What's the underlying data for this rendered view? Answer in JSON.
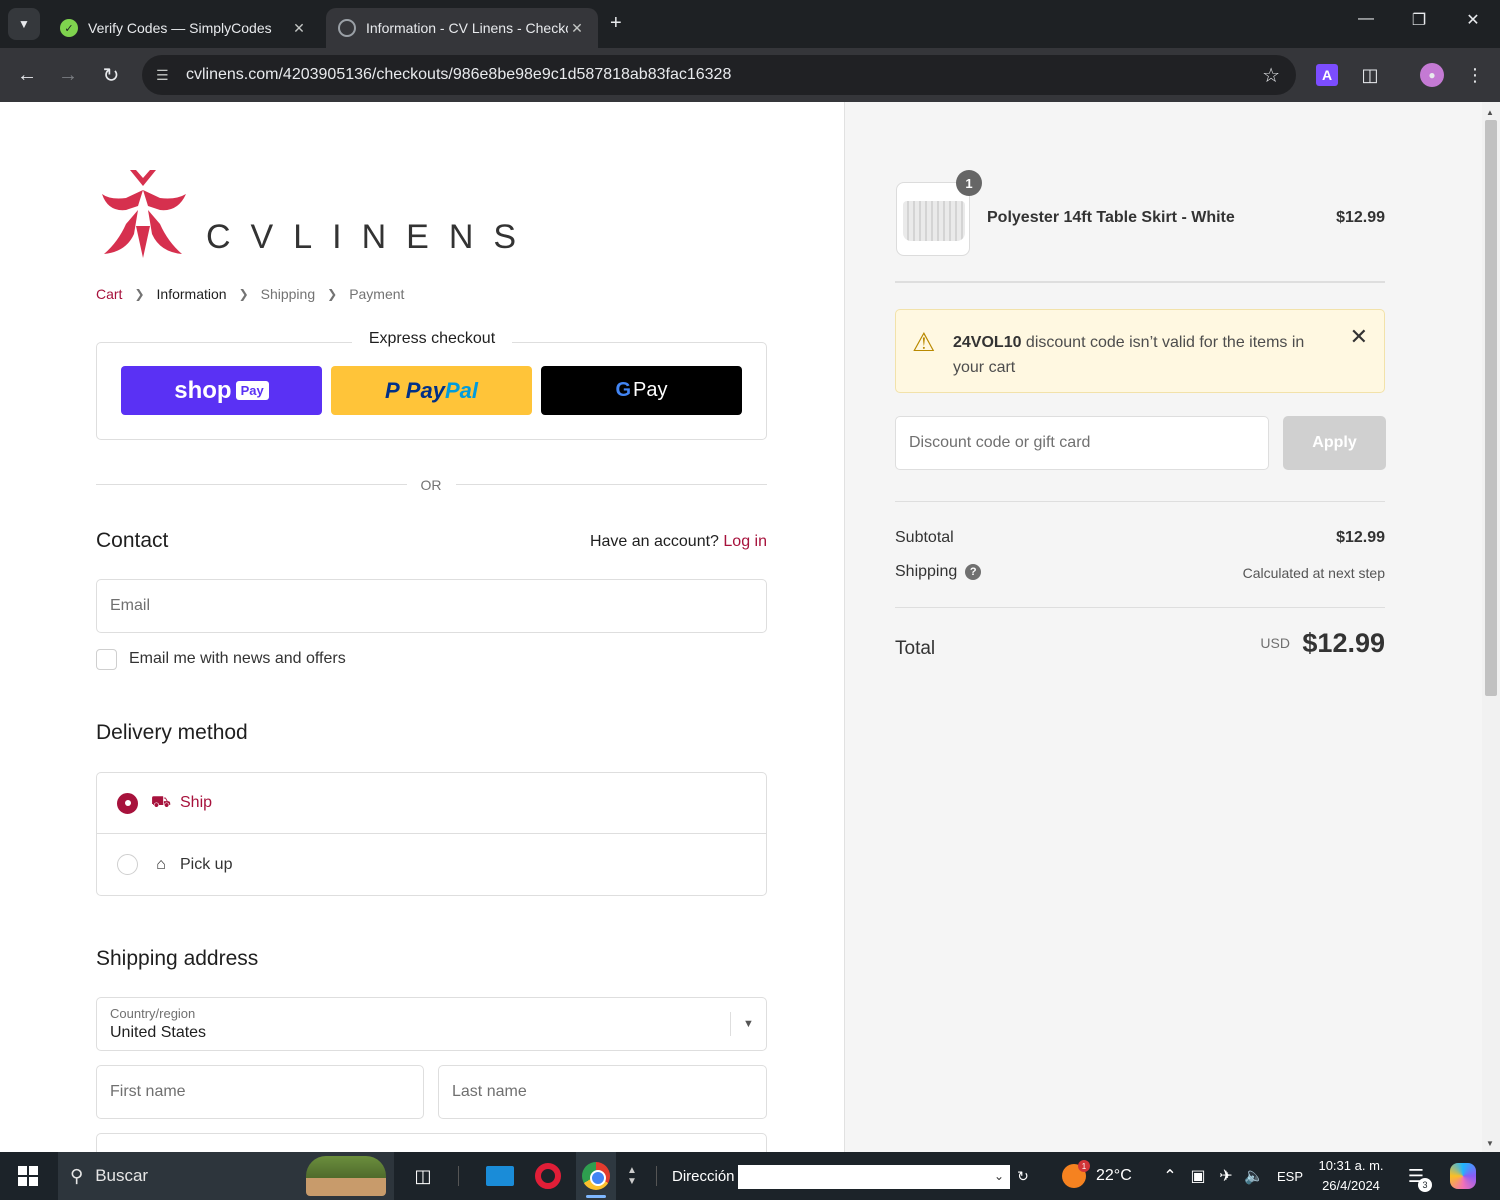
{
  "browser": {
    "tabs": [
      {
        "title": "Verify Codes — SimplyCodes",
        "active": false
      },
      {
        "title": "Information - CV Linens - Checkout",
        "active": true
      }
    ],
    "url": "cvlinens.com/4203905136/checkouts/986e8be98e9c1d587818ab83fac16328",
    "extension_letter": "A"
  },
  "logo": {
    "wordmark": "CVLINENS",
    "brand_color": "#d6304e"
  },
  "breadcrumbs": [
    {
      "label": "Cart",
      "state": "link"
    },
    {
      "label": "Information",
      "state": "current"
    },
    {
      "label": "Shipping",
      "state": "upcoming"
    },
    {
      "label": "Payment",
      "state": "upcoming"
    }
  ],
  "express": {
    "label": "Express checkout",
    "shop": "shop",
    "shop_pay": "Pay",
    "paypal_1": "Pay",
    "paypal_2": "Pal",
    "gpay_g": "G",
    "gpay": "Pay",
    "or": "OR"
  },
  "contact": {
    "heading": "Contact",
    "account_prompt": "Have an account?",
    "login": "Log in",
    "email_placeholder": "Email",
    "newsletter_label": "Email me with news and offers",
    "newsletter_checked": false
  },
  "delivery": {
    "heading": "Delivery method",
    "options": [
      {
        "label": "Ship",
        "selected": true,
        "icon": "truck-icon"
      },
      {
        "label": "Pick up",
        "selected": false,
        "icon": "store-icon"
      }
    ]
  },
  "shipping": {
    "heading": "Shipping address",
    "country_label": "Country/region",
    "country_value": "United States",
    "first_name_placeholder": "First name",
    "last_name_placeholder": "Last name"
  },
  "summary": {
    "product": {
      "name": "Polyester 14ft Table Skirt - White",
      "price": "$12.99",
      "quantity": "1"
    },
    "warning": {
      "code": "24VOL10",
      "message": " discount code isn’t valid for the items in your cart"
    },
    "discount_placeholder": "Discount code or gift card",
    "apply_label": "Apply",
    "subtotal_label": "Subtotal",
    "subtotal_value": "$12.99",
    "shipping_label": "Shipping",
    "shipping_value": "Calculated at next step",
    "total_label": "Total",
    "currency": "USD",
    "total_value": "$12.99"
  },
  "taskbar": {
    "search": "Buscar",
    "address_label": "Dirección",
    "temperature": "22°C",
    "weather_badge": "1",
    "language": "ESP",
    "time": "10:31 a. m.",
    "date": "26/4/2024",
    "notification_count": "3"
  },
  "colors": {
    "accent": "#a7123c",
    "shop_pay": "#5a31f4",
    "paypal": "#ffc439",
    "warning_bg": "#fff8e1"
  }
}
